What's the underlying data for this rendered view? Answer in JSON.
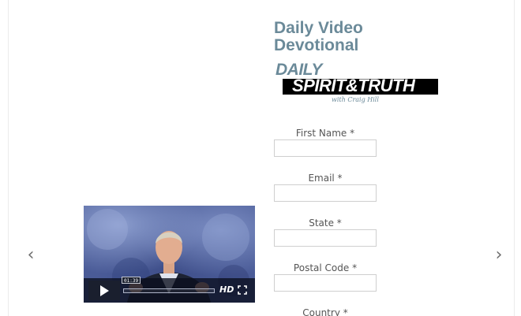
{
  "heading": {
    "title": "Daily Video Devotional"
  },
  "logo": {
    "daily": "DAILY",
    "spirit_truth": "SPIRIT&TRUTH",
    "byline": "with Craig Hill"
  },
  "video": {
    "time": "01:39",
    "progress": 0.0,
    "hd_label": "HD",
    "play_icon": "play-icon",
    "fullscreen_icon": "fullscreen-icon"
  },
  "carousel": {
    "prev_glyph": "‹",
    "next_glyph": "›"
  },
  "form": {
    "fields": [
      {
        "label": "First Name *",
        "value": ""
      },
      {
        "label": "Email *",
        "value": ""
      },
      {
        "label": "State *",
        "value": ""
      },
      {
        "label": "Postal Code *",
        "value": ""
      },
      {
        "label": "Country *",
        "value": ""
      }
    ]
  },
  "colors": {
    "heading": "#6b8a99",
    "video_bg": "#4a5b97",
    "logo_bar": "#000000"
  }
}
